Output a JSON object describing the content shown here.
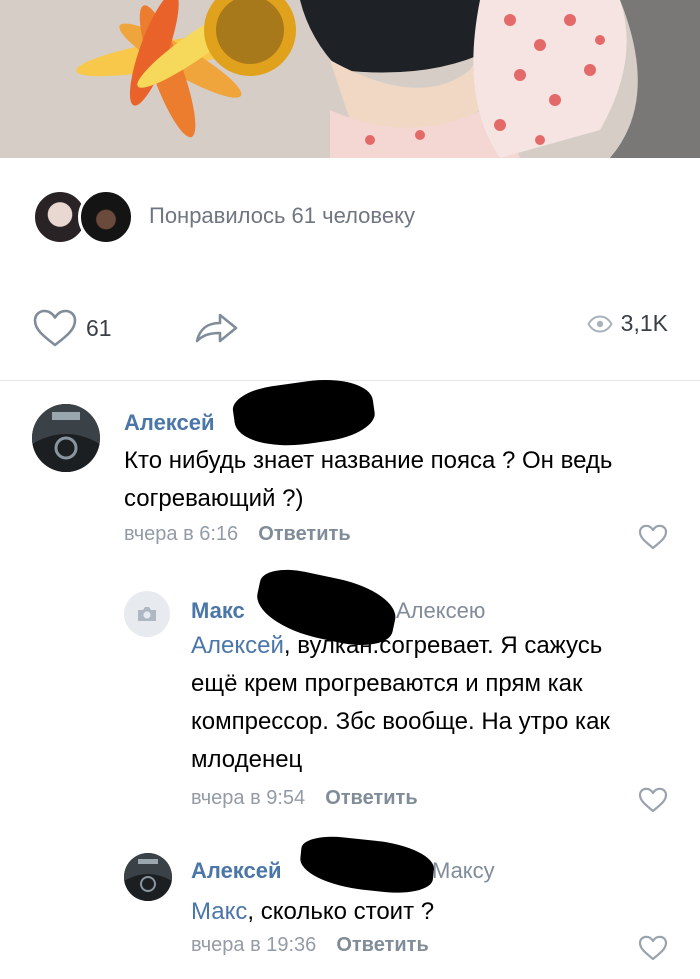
{
  "post": {
    "likers_text": "Понравилось 61 человеку",
    "like_count": "61",
    "views_count": "3,1K"
  },
  "comments": [
    {
      "author": "Алексей",
      "text": "Кто нибудь знает название пояса ? Он ведь согревающий ?)",
      "time": "вчера в 6:16",
      "reply_label": "Ответить"
    },
    {
      "author": "Макс",
      "reply_to": "Алексею",
      "mention": "Алексей",
      "text": ", вулкан.согревает. Я сажусь ещё крем прогреваются и прям как компрессор. Збс вообще. На утро как млоденец",
      "time": "вчера в 9:54",
      "reply_label": "Ответить"
    },
    {
      "author": "Алексей",
      "reply_to": "Максу",
      "mention": "Макс",
      "text": ", сколько стоит ?",
      "time": "вчера в 19:36",
      "reply_label": "Ответить"
    }
  ],
  "colors": {
    "link": "#4a76a8",
    "secondary": "#818c99",
    "icon": "#99a2ad"
  },
  "icons": [
    "heart-icon",
    "share-icon",
    "eye-icon",
    "camera-icon"
  ]
}
